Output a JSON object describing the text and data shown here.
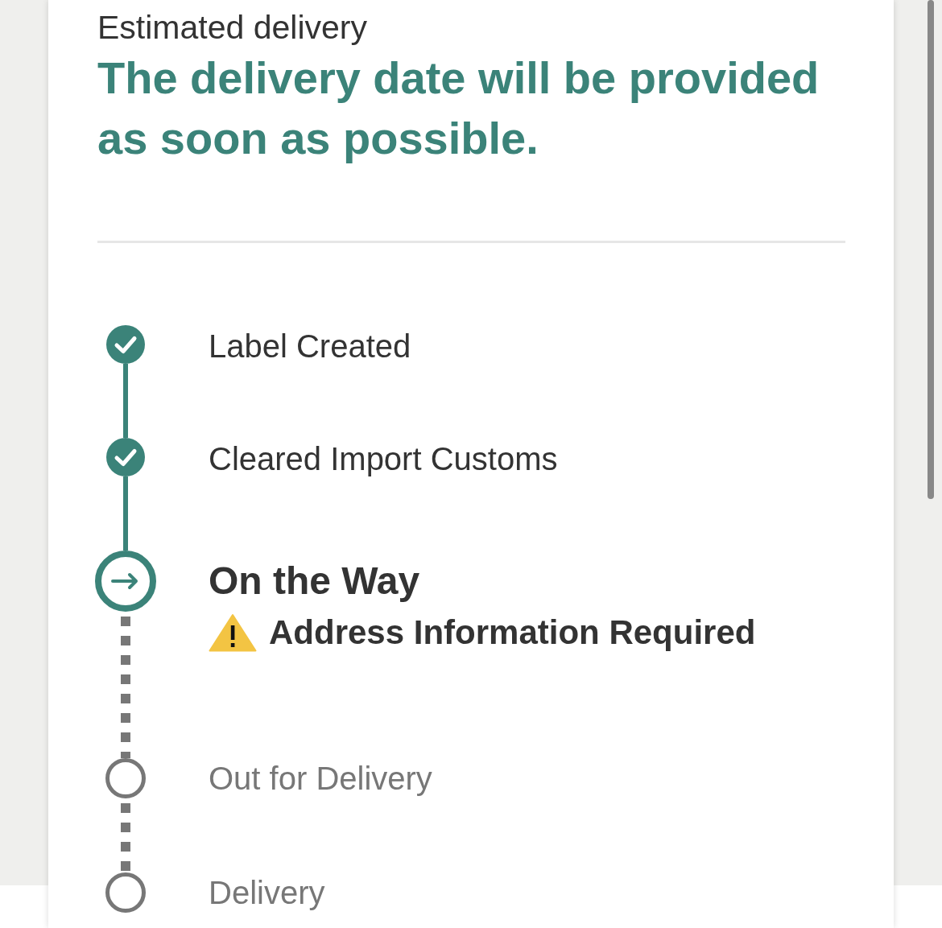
{
  "estimate": {
    "label": "Estimated delivery",
    "message": "The delivery date will be provided as soon as possible."
  },
  "steps": [
    {
      "kind": "done",
      "label": "Label Created"
    },
    {
      "kind": "done",
      "label": "Cleared Import Customs"
    },
    {
      "kind": "current",
      "label": "On the Way",
      "alert": {
        "kind": "warning",
        "text": "Address Information Required"
      }
    },
    {
      "kind": "pending",
      "label": "Out for Delivery"
    },
    {
      "kind": "pending",
      "label": "Delivery"
    }
  ]
}
